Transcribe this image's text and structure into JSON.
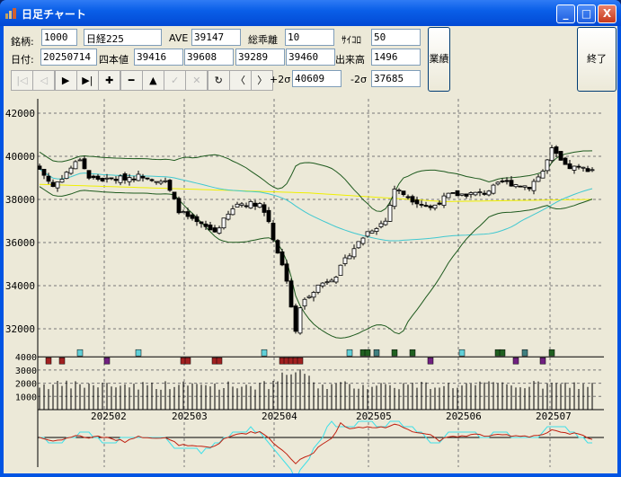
{
  "window": {
    "title": "日足チャート",
    "minimize": "_",
    "maximize": "□",
    "close": "X"
  },
  "form": {
    "code_label": "銘柄:",
    "code": "1000",
    "name": "日経225",
    "ave_label": "AVE",
    "ave": "39147",
    "kairi_label": "総乖離",
    "kairi": "10",
    "saikoro_label": "ｻｲｺﾛ",
    "saikoro": "50",
    "date_label": "日付:",
    "date": "20250714",
    "ohlc_label": "四本値",
    "open": "39416",
    "high": "39608",
    "low": "39289",
    "close": "39460",
    "volume_label": "出来高",
    "volume": "1496",
    "plus2s_label": "+2σ",
    "plus2s": "40609",
    "minus2s_label": "-2σ",
    "minus2s": "37685",
    "gyoseki": "業績",
    "exit": "終了"
  },
  "toolbar": [
    {
      "name": "first",
      "glyph": "|◁",
      "enabled": false
    },
    {
      "name": "prev",
      "glyph": "◁",
      "enabled": false
    },
    {
      "name": "play",
      "glyph": "▶",
      "enabled": true
    },
    {
      "name": "last",
      "glyph": "▶|",
      "enabled": true
    },
    {
      "name": "zoom-in",
      "glyph": "✚",
      "enabled": true
    },
    {
      "name": "zoom-out",
      "glyph": "━",
      "enabled": true
    },
    {
      "name": "up",
      "glyph": "▲",
      "enabled": true
    },
    {
      "name": "check",
      "glyph": "✓",
      "enabled": false
    },
    {
      "name": "cross",
      "glyph": "✕",
      "enabled": false
    },
    {
      "name": "refresh",
      "glyph": "↻",
      "enabled": true
    },
    {
      "name": "scroll-left",
      "glyph": "〈",
      "enabled": true
    },
    {
      "name": "scroll-right",
      "glyph": "〉",
      "enabled": true
    }
  ],
  "chart_data": {
    "type": "candlestick",
    "price_ticks": [
      42000,
      40000,
      38000,
      36000,
      34000,
      32000
    ],
    "volume_ticks": [
      4000,
      3000,
      2000,
      1000
    ],
    "months": [
      {
        "label": "202502",
        "day": 15
      },
      {
        "label": "202503",
        "day": 33
      },
      {
        "label": "202504",
        "day": 53
      },
      {
        "label": "202505",
        "day": 74
      },
      {
        "label": "202506",
        "day": 94
      },
      {
        "label": "202507",
        "day": 114
      }
    ],
    "close_anchors": [
      [
        0,
        39400
      ],
      [
        3,
        38600
      ],
      [
        9,
        39900
      ],
      [
        11,
        39000
      ],
      [
        15,
        38900
      ],
      [
        23,
        39100
      ],
      [
        28,
        38800
      ],
      [
        31,
        37500
      ],
      [
        34,
        37000
      ],
      [
        39,
        36500
      ],
      [
        44,
        37800
      ],
      [
        49,
        37800
      ],
      [
        51,
        37000
      ],
      [
        52,
        36200
      ],
      [
        55,
        34300
      ],
      [
        57,
        31800
      ],
      [
        58,
        33000
      ],
      [
        60,
        33600
      ],
      [
        62,
        34000
      ],
      [
        66,
        34500
      ],
      [
        69,
        35500
      ],
      [
        73,
        36500
      ],
      [
        77,
        37000
      ],
      [
        79,
        38500
      ],
      [
        83,
        38000
      ],
      [
        87,
        37600
      ],
      [
        91,
        38200
      ],
      [
        99,
        38300
      ],
      [
        103,
        38800
      ],
      [
        109,
        38600
      ],
      [
        112,
        39300
      ],
      [
        114,
        40300
      ],
      [
        117,
        39500
      ],
      [
        123,
        39400
      ]
    ],
    "long_ma_anchors": [
      [
        0,
        38700
      ],
      [
        30,
        38500
      ],
      [
        60,
        38300
      ],
      [
        90,
        37900
      ],
      [
        123,
        38000
      ]
    ],
    "days": 124,
    "colors": {
      "up": "#ffffff",
      "down": "#000000",
      "band": "#1e5a1e",
      "ma": "#40c8d0",
      "long_ma": "#f0f000",
      "osc1": "#c02010",
      "osc2": "#40e0e8"
    }
  }
}
